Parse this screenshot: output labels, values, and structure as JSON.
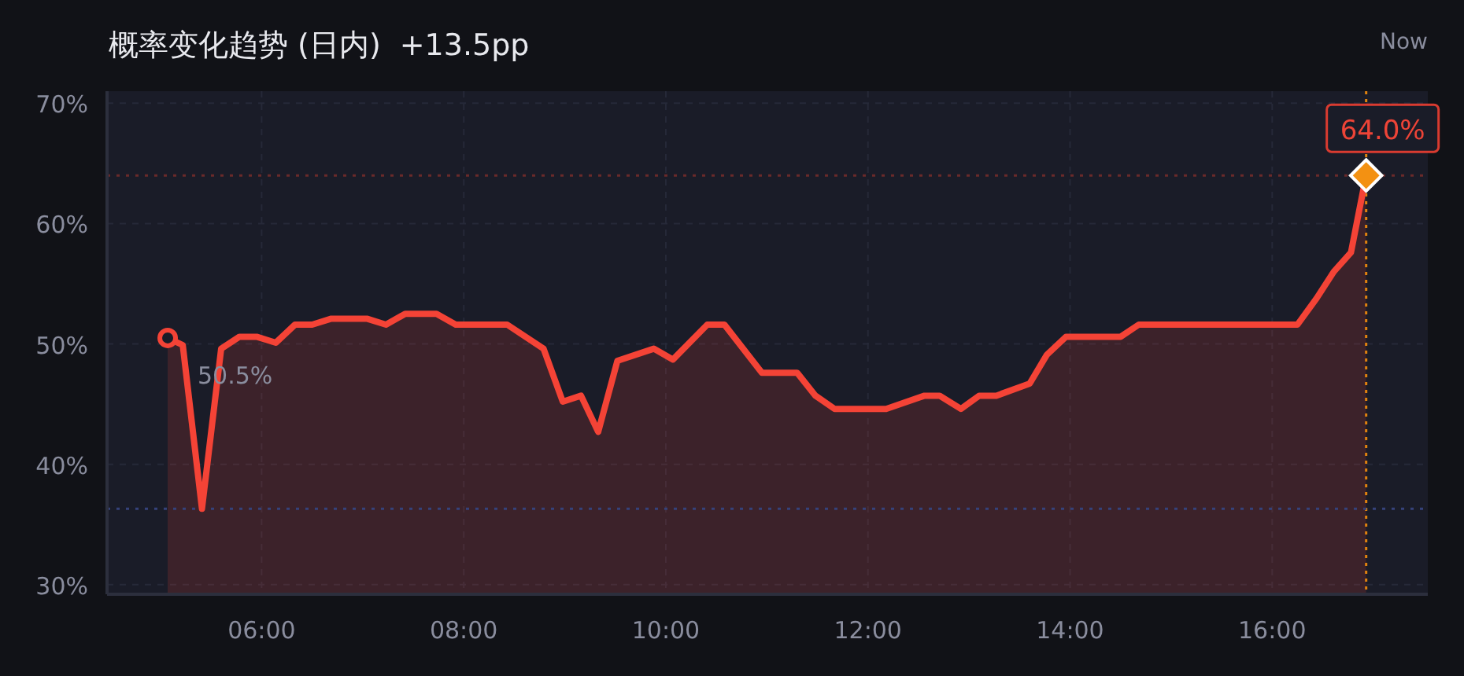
{
  "header": {
    "title": "概率变化趋势 (日内)",
    "change": "+13.5pp",
    "now_label": "Now"
  },
  "chart": {
    "chart_data": {
      "type": "area",
      "x": [
        5.07,
        5.22,
        5.41,
        5.6,
        5.78,
        5.95,
        6.14,
        6.33,
        6.5,
        6.69,
        7.04,
        7.23,
        7.42,
        7.73,
        7.92,
        8.43,
        8.79,
        8.98,
        9.16,
        9.33,
        9.52,
        9.88,
        10.07,
        10.41,
        10.58,
        10.95,
        11.3,
        11.48,
        11.67,
        12.18,
        12.56,
        12.71,
        12.92,
        13.1,
        13.27,
        13.6,
        13.77,
        13.96,
        14.5,
        14.68,
        16.25,
        16.44,
        16.61,
        16.78,
        16.93
      ],
      "series": [
        {
          "color": "#f44336",
          "values": [
            50.5,
            49.9,
            36.3,
            49.6,
            50.6,
            50.6,
            50.1,
            51.6,
            51.6,
            52.1,
            52.1,
            51.6,
            52.5,
            52.5,
            51.6,
            51.6,
            49.6,
            45.2,
            45.7,
            42.7,
            48.6,
            49.6,
            48.7,
            51.6,
            51.6,
            47.6,
            47.6,
            45.7,
            44.6,
            44.6,
            45.7,
            45.7,
            44.6,
            45.7,
            45.7,
            46.7,
            49.1,
            50.6,
            50.6,
            51.6,
            51.6,
            53.8,
            56.0,
            57.6,
            64.0
          ]
        }
      ],
      "xlim": [
        4.47,
        17.54
      ],
      "ylim": [
        29.2,
        71.0
      ],
      "xticks": [
        {
          "value": 6,
          "label": "06:00"
        },
        {
          "value": 8,
          "label": "08:00"
        },
        {
          "value": 10,
          "label": "10:00"
        },
        {
          "value": 12,
          "label": "12:00"
        },
        {
          "value": 14,
          "label": "14:00"
        },
        {
          "value": 16,
          "label": "16:00"
        }
      ],
      "yticks": [
        {
          "value": 30,
          "label": "30%"
        },
        {
          "value": 40,
          "label": "40%"
        },
        {
          "value": 50,
          "label": "50%"
        },
        {
          "value": 60,
          "label": "60%"
        },
        {
          "value": 70,
          "label": "70%"
        }
      ],
      "grid": true,
      "ref_lines": [
        {
          "axis": "y",
          "value": 64.0,
          "color": "#6a2a2a"
        },
        {
          "axis": "x",
          "value": 16.93,
          "color": "#e0820e"
        },
        {
          "axis": "y",
          "value": 36.3,
          "color": "#35427a"
        }
      ],
      "annotations": [
        {
          "x": 5.07,
          "y": 50.5,
          "text": "50.5%"
        },
        {
          "x": 16.93,
          "y": 64.0,
          "text": "64.0%"
        }
      ]
    }
  }
}
